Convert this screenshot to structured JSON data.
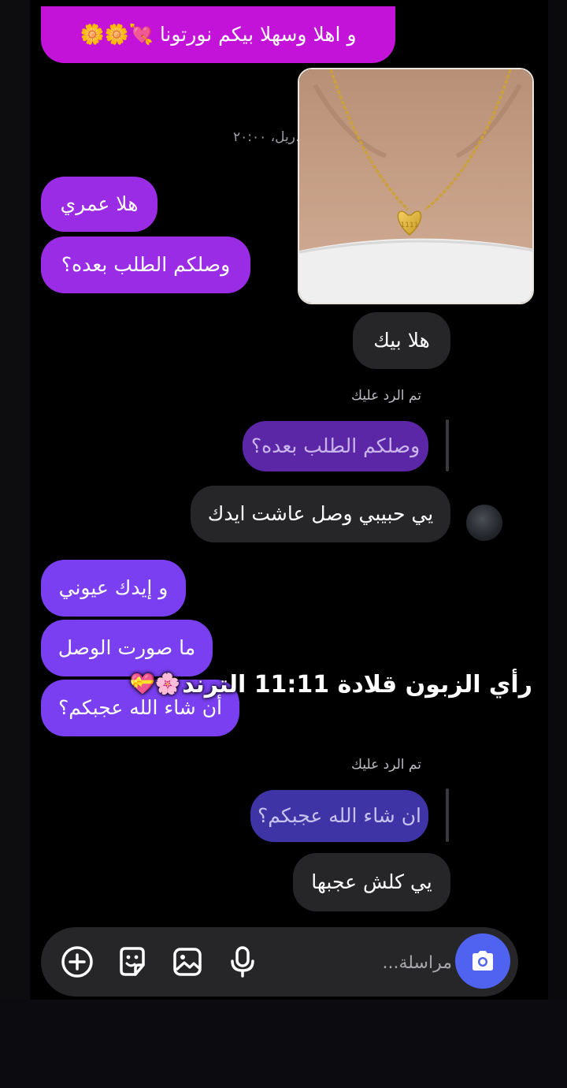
{
  "messages": {
    "m1": "و اهلا وسهلا بيكم نورتونا 💘🌼🌼",
    "timestamp": "…ريل، ٢٠:٠٠",
    "m2": "هلا عمري",
    "m3": "وصلكم الطلب بعده؟",
    "m4": "هلا بيك",
    "reply_label_1": "تم الرد عليك",
    "quoted_1": "وصلكم الطلب بعده؟",
    "m5": "يي حبيبي وصل عاشت ايدك",
    "m6": "و إيدك عيوني",
    "m7": "ما صورت الوصل",
    "m8": "أن شاء الله عجبكم؟",
    "reply_label_2": "تم الرد عليك",
    "quoted_2": "ان شاء الله عجبكم؟",
    "m9": "يي كلش عجبها"
  },
  "overlay": {
    "title": "رأي الزبون قلادة 11:11 الترند",
    "emoji": "🌸💝"
  },
  "composer": {
    "placeholder": "مراسلة...",
    "icons": [
      "camera-icon",
      "microphone-icon",
      "gallery-icon",
      "sticker-icon",
      "plus-icon"
    ]
  },
  "colors": {
    "sent_magenta": "#c313d9",
    "sent_purple": "#9a2ce6",
    "sent_violet": "#7a3ff0",
    "received": "#262629",
    "camera_button": "#4f63f0"
  }
}
